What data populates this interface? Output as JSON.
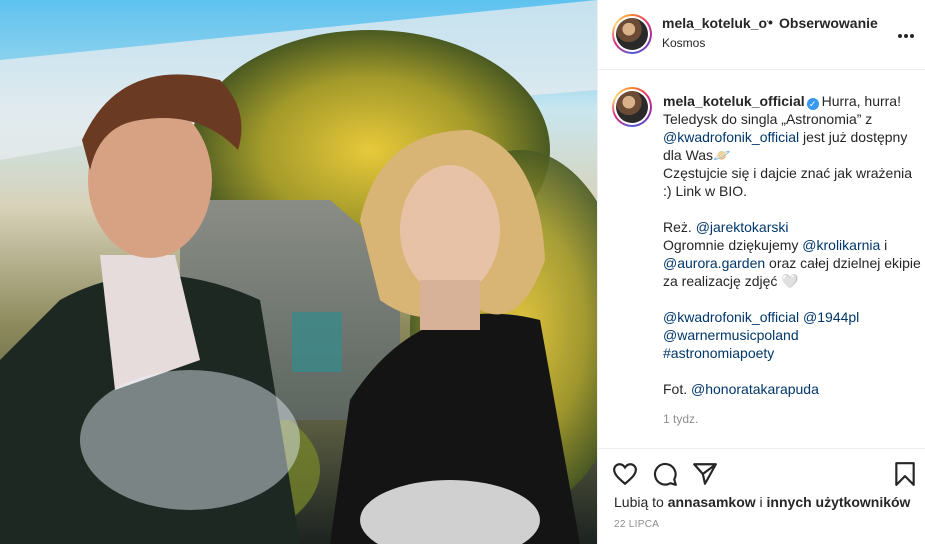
{
  "header": {
    "username": "mela_koteluk_official",
    "separator": "•",
    "follow_status": "Obserwowanie",
    "location": "Kosmos",
    "more_icon": "more-horizontal-icon"
  },
  "caption": {
    "username": "mela_koteluk_official",
    "verified_icon": "verified-badge-icon",
    "line1": "Hurra, hurra! Teledysk do singla „Astronomia” z ",
    "mention1": "@kwadrofonik_official",
    "line1b": " jest już dostępny dla Was",
    "emoji1": "🪐",
    "line2": "Częstujcie się i dajcie znać jak wrażenia :) Link w BIO.",
    "director_label": "Reż. ",
    "mention_director": "@jarektokarski",
    "thanks_a": "Ogromnie dziękujemy ",
    "mention2": "@krolikarnia",
    "thanks_b": " i ",
    "mention3": "@aurora.garden",
    "thanks_c": " oraz całej dzielnej ekipie za realizację zdjęć ",
    "emoji2": "🤍",
    "tag1": "@kwadrofonik_official",
    "tag2": "@1944pl",
    "tag3": "@warnermusicpoland",
    "hashtag": "#astronomiapoety",
    "photo_label": "Fot. ",
    "mention_photo": "@honoratakarapuda",
    "time_ago": "1 tydz."
  },
  "actions": {
    "like_icon": "heart-icon",
    "comment_icon": "comment-icon",
    "share_icon": "share-icon",
    "save_icon": "bookmark-icon",
    "likes_prefix": "Lubią to ",
    "likes_user": "annasamkow",
    "likes_mid": " i ",
    "likes_others": "innych użytkowników",
    "date": "22 LIPCA"
  },
  "colors": {
    "link": "#00376b",
    "verified": "#3897f0",
    "muted": "#8e8e8e"
  }
}
